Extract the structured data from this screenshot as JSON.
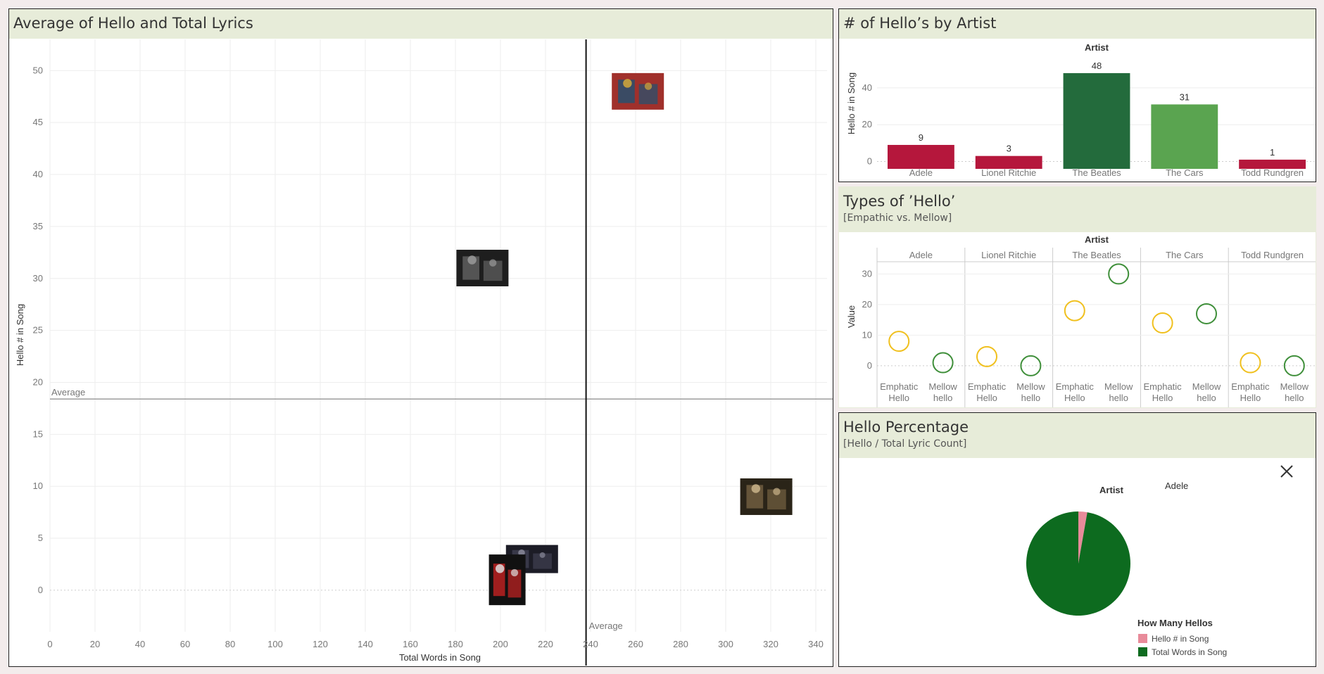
{
  "panels": {
    "scatter": {
      "title": "Average of Hello and Total Lyrics"
    },
    "bar": {
      "title": "# of Hello’s by Artist"
    },
    "types": {
      "title": "Types of ’Hello’",
      "subtitle": "[Empathic vs. Mellow]"
    },
    "pie": {
      "title": "Hello Percentage",
      "subtitle": "[Hello / Total Lyric Count]"
    }
  },
  "chart_data": [
    {
      "type": "scatter",
      "title": "Average of Hello and Total Lyrics",
      "xlabel": "Total Words in Song",
      "ylabel": "Hello # in Song",
      "xlim": [
        0,
        345
      ],
      "ylim": [
        -4,
        53
      ],
      "xticks": [
        0,
        20,
        40,
        60,
        80,
        100,
        120,
        140,
        160,
        180,
        200,
        220,
        240,
        260,
        280,
        300,
        320,
        340
      ],
      "yticks": [
        0,
        5,
        10,
        15,
        20,
        25,
        30,
        35,
        40,
        45,
        50
      ],
      "grid": true,
      "points": [
        {
          "artist": "The Beatles",
          "x": 261,
          "y": 48,
          "marker": "album-cover-image",
          "colors": [
            "#a0302b",
            "#2f4f6a",
            "#d4a83a"
          ]
        },
        {
          "artist": "The Cars",
          "x": 192,
          "y": 31,
          "marker": "band-photo-image",
          "colors": [
            "#1e1e1e",
            "#5a5a5a",
            "#9a9a9a"
          ]
        },
        {
          "artist": "Adele",
          "x": 318,
          "y": 9,
          "marker": "singer-photo-image",
          "colors": [
            "#2a2418",
            "#6b5a3d",
            "#c9b48a"
          ]
        },
        {
          "artist": "Lionel Ritchie",
          "x": 214,
          "y": 3,
          "marker": "singer-photo-image",
          "colors": [
            "#1c1c26",
            "#3c3c4c",
            "#8a8a9a"
          ]
        },
        {
          "artist": "Todd Rundgren",
          "x": 203,
          "y": 1,
          "marker": "guitarist-photo-image",
          "colors": [
            "#111111",
            "#b02020",
            "#dddddd"
          ]
        }
      ],
      "reference_lines": [
        {
          "axis": "y",
          "value": 18.4,
          "label": "Average"
        },
        {
          "axis": "x",
          "value": 238,
          "label": "Average"
        }
      ]
    },
    {
      "type": "bar",
      "title": "# of Hello’s by Artist",
      "header": "Artist",
      "ylabel": "Hello # in Song",
      "categories": [
        "Adele",
        "Lionel Ritchie",
        "The Beatles",
        "The Cars",
        "Todd Rundgren"
      ],
      "values": [
        9,
        3,
        48,
        31,
        1
      ],
      "colors": [
        "#b5173c",
        "#b5173c",
        "#236b3c",
        "#5aa450",
        "#b5173c"
      ],
      "yticks": [
        0,
        20,
        40
      ],
      "ylim": [
        -4,
        56
      ],
      "data_labels": true
    },
    {
      "type": "scatter",
      "title": "Types of ’Hello’",
      "subtitle": "[Empathic vs. Mellow]",
      "header": "Artist",
      "ylabel": "Value",
      "artists": [
        "Adele",
        "Lionel Ritchie",
        "The Beatles",
        "The Cars",
        "Todd Rundgren"
      ],
      "subcategories": [
        "Emphatic Hello",
        "Mellow hello"
      ],
      "series": [
        {
          "name": "Emphatic Hello",
          "color": "#f0c01e",
          "values": [
            8,
            3,
            18,
            14,
            1
          ]
        },
        {
          "name": "Mellow hello",
          "color": "#3f8f3a",
          "values": [
            1,
            0,
            30,
            17,
            0
          ]
        }
      ],
      "yticks": [
        0,
        10,
        20,
        30
      ],
      "ylim": [
        -6,
        34
      ]
    },
    {
      "type": "pie",
      "title": "Hello Percentage",
      "subtitle": "[Hello / Total Lyric Count]",
      "header": "Artist",
      "filter_value": "Adele",
      "slices": [
        {
          "label": "Hello # in Song",
          "value": 9,
          "color": "#e88b9a"
        },
        {
          "label": "Total Words in Song",
          "value": 318,
          "color": "#0d6b1f"
        }
      ],
      "legend_title": "How Many Hellos",
      "legend_position": "bottom-right"
    }
  ]
}
